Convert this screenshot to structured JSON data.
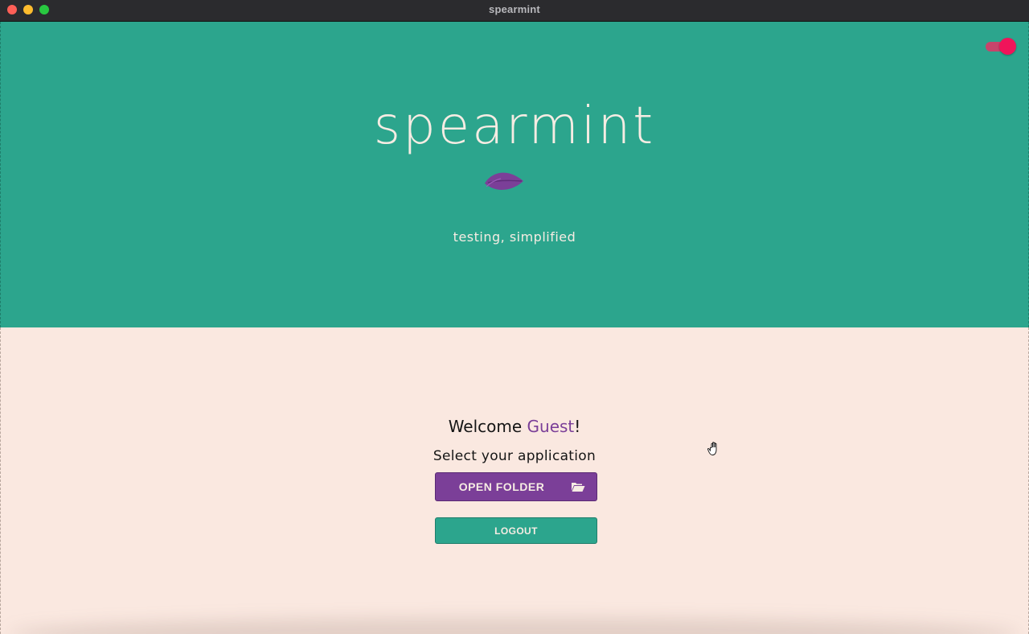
{
  "window": {
    "title": "spearmint"
  },
  "hero": {
    "title": "spearmint",
    "tagline": "testing, simplified",
    "logo_icon": "leaf-icon"
  },
  "theme_toggle": {
    "icon": "toggle-switch",
    "state": "on"
  },
  "content": {
    "welcome_prefix": "Welcome ",
    "user_name": "Guest",
    "welcome_suffix": "!",
    "select_prompt": "Select your application",
    "open_folder_label": "OPEN FOLDER",
    "open_folder_icon": "folder-open-icon",
    "logout_label": "LOGOUT"
  },
  "colors": {
    "mint": "#2ca58d",
    "purple": "#7b3f98",
    "cream": "#fae8e0",
    "text_light": "#f6ece3",
    "toggle_knob": "#f0145a"
  }
}
